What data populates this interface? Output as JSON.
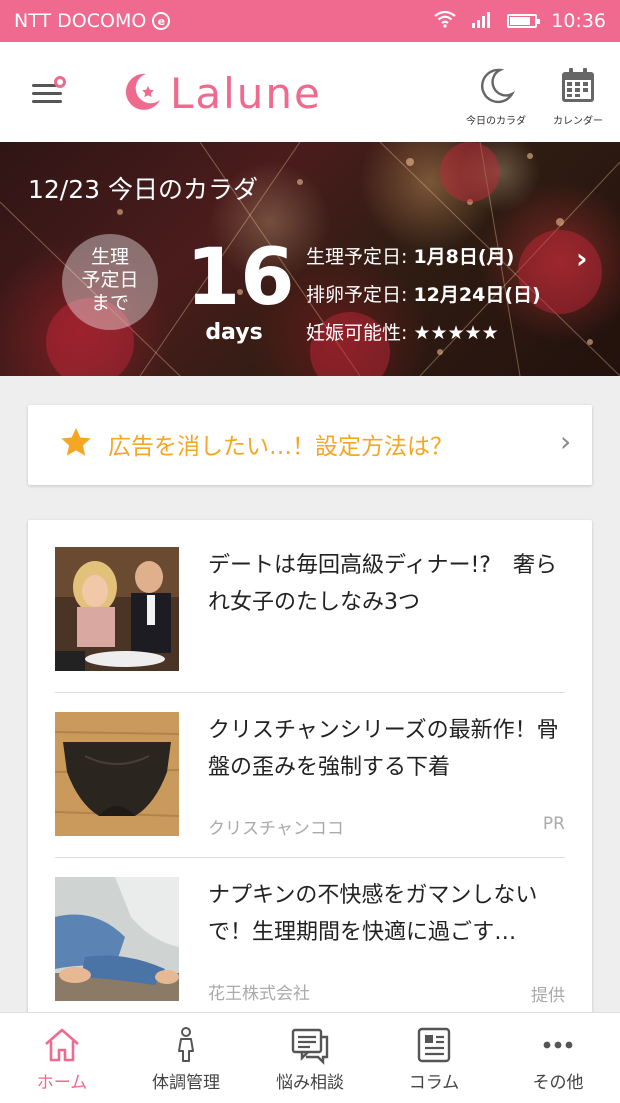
{
  "status_bar": {
    "carrier": "NTT DOCOMO",
    "carrier_badge": "e",
    "time": "10:36",
    "battery_level": 0.85
  },
  "header": {
    "logo_text": "Lalune",
    "today_body_label": "今日のカラダ",
    "calendar_label": "カレンダー"
  },
  "hero": {
    "date_title": "12/23 今日のカラダ",
    "circle_lines": [
      "生理",
      "予定日",
      "まで"
    ],
    "days_count": "16",
    "days_unit": "days",
    "period_label": "生理予定日:",
    "period_value": "1月8日(月)",
    "ovulation_label": "排卵予定日:",
    "ovulation_value": "12月24日(日)",
    "fertility_label": "妊娠可能性:",
    "fertility_value": "★★★★★",
    "fertility_rating": 5
  },
  "ad_banner": {
    "text": "広告を消したい…！設定方法は？"
  },
  "articles": [
    {
      "title": "デートは毎回高級ディナー!?　奢られ女子のたしなみ3つ",
      "source": "",
      "tag": ""
    },
    {
      "title": "クリスチャンシリーズの最新作！骨盤の歪みを強制する下着",
      "source": "クリスチャンココ",
      "tag": "PR"
    },
    {
      "title": "ナプキンの不快感をガマンしないで！生理期間を快適に過ごす…",
      "source": "花王株式会社",
      "tag": "提供"
    }
  ],
  "bottom_nav": {
    "home": "ホーム",
    "condition": "体調管理",
    "consult": "悩み相談",
    "column": "コラム",
    "other": "その他"
  },
  "colors": {
    "brand": "#ef6a8e",
    "ad_text": "#f5a623"
  }
}
